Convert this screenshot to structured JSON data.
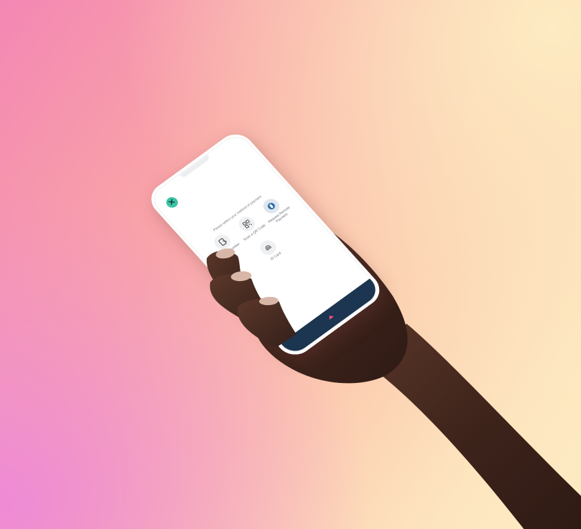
{
  "scene": {
    "description_colors": {
      "background_top_right": "#fdebc4",
      "background_left": "#f487b4",
      "skin": "#4a2c22",
      "nail": "#d9b6a8"
    }
  },
  "phone_screen": {
    "close_icon": "close-icon",
    "prompt": "Please select your method of payment",
    "options": [
      {
        "label": "Mobile Number",
        "icon": "mobile-phone-icon"
      },
      {
        "label": "Scan a QR Code",
        "icon": "qr-code-icon"
      },
      {
        "label": "Request Remote Payment",
        "icon": "remote-payment-icon"
      },
      {
        "label": "ID Card",
        "icon": "fingerprint-icon"
      }
    ],
    "bottom_bar_color": "#1c3550",
    "accent": "#3cc2a4",
    "arrow_color": "#e84e7a"
  }
}
